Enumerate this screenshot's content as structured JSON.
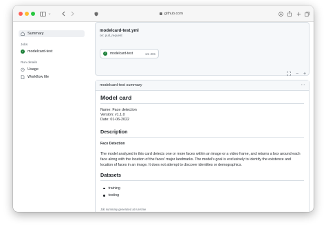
{
  "browser": {
    "url": "github.com",
    "icons": [
      "sidebar-icon",
      "back-icon",
      "forward-icon",
      "shield-icon",
      "download-icon",
      "share-icon",
      "new-tab-icon",
      "tabs-overview-icon"
    ]
  },
  "sidebar": {
    "summary_label": "Summary",
    "jobs_heading": "Jobs",
    "job_label": "modelcard-test",
    "run_details_heading": "Run details",
    "usage_label": "Usage",
    "workflow_file_label": "Workflow file"
  },
  "workflow": {
    "file": "modelcard-test.yml",
    "trigger": "on: pull_request",
    "job_name": "modelcard-test",
    "job_duration": "1m 20s",
    "zoom_controls": [
      "fullscreen-icon",
      "zoom-out-icon",
      "zoom-in-icon"
    ]
  },
  "summary": {
    "header": "modelcard-test summary",
    "title": "Model card",
    "name_line": "Name: Face detection",
    "version_line": "Version: v1.1.0",
    "date_line": "Date: 01-06-2022",
    "description_heading": "Description",
    "subheading": "Face Detection",
    "paragraph": "The model analyzed in this card detects one or more faces within an image or a video frame, and returns a box around each face along with the location of the faces' major landmarks. The model's goal is exclusively to identify the existence and location of faces in an image. It does not attempt to discover identities or demographics.",
    "datasets_heading": "Datasets",
    "datasets": [
      "training",
      "testing"
    ],
    "footer": "Job summary generated at run-time"
  },
  "colors": {
    "success": "#1a7f37",
    "border": "#d8dee4",
    "muted": "#656d76"
  }
}
